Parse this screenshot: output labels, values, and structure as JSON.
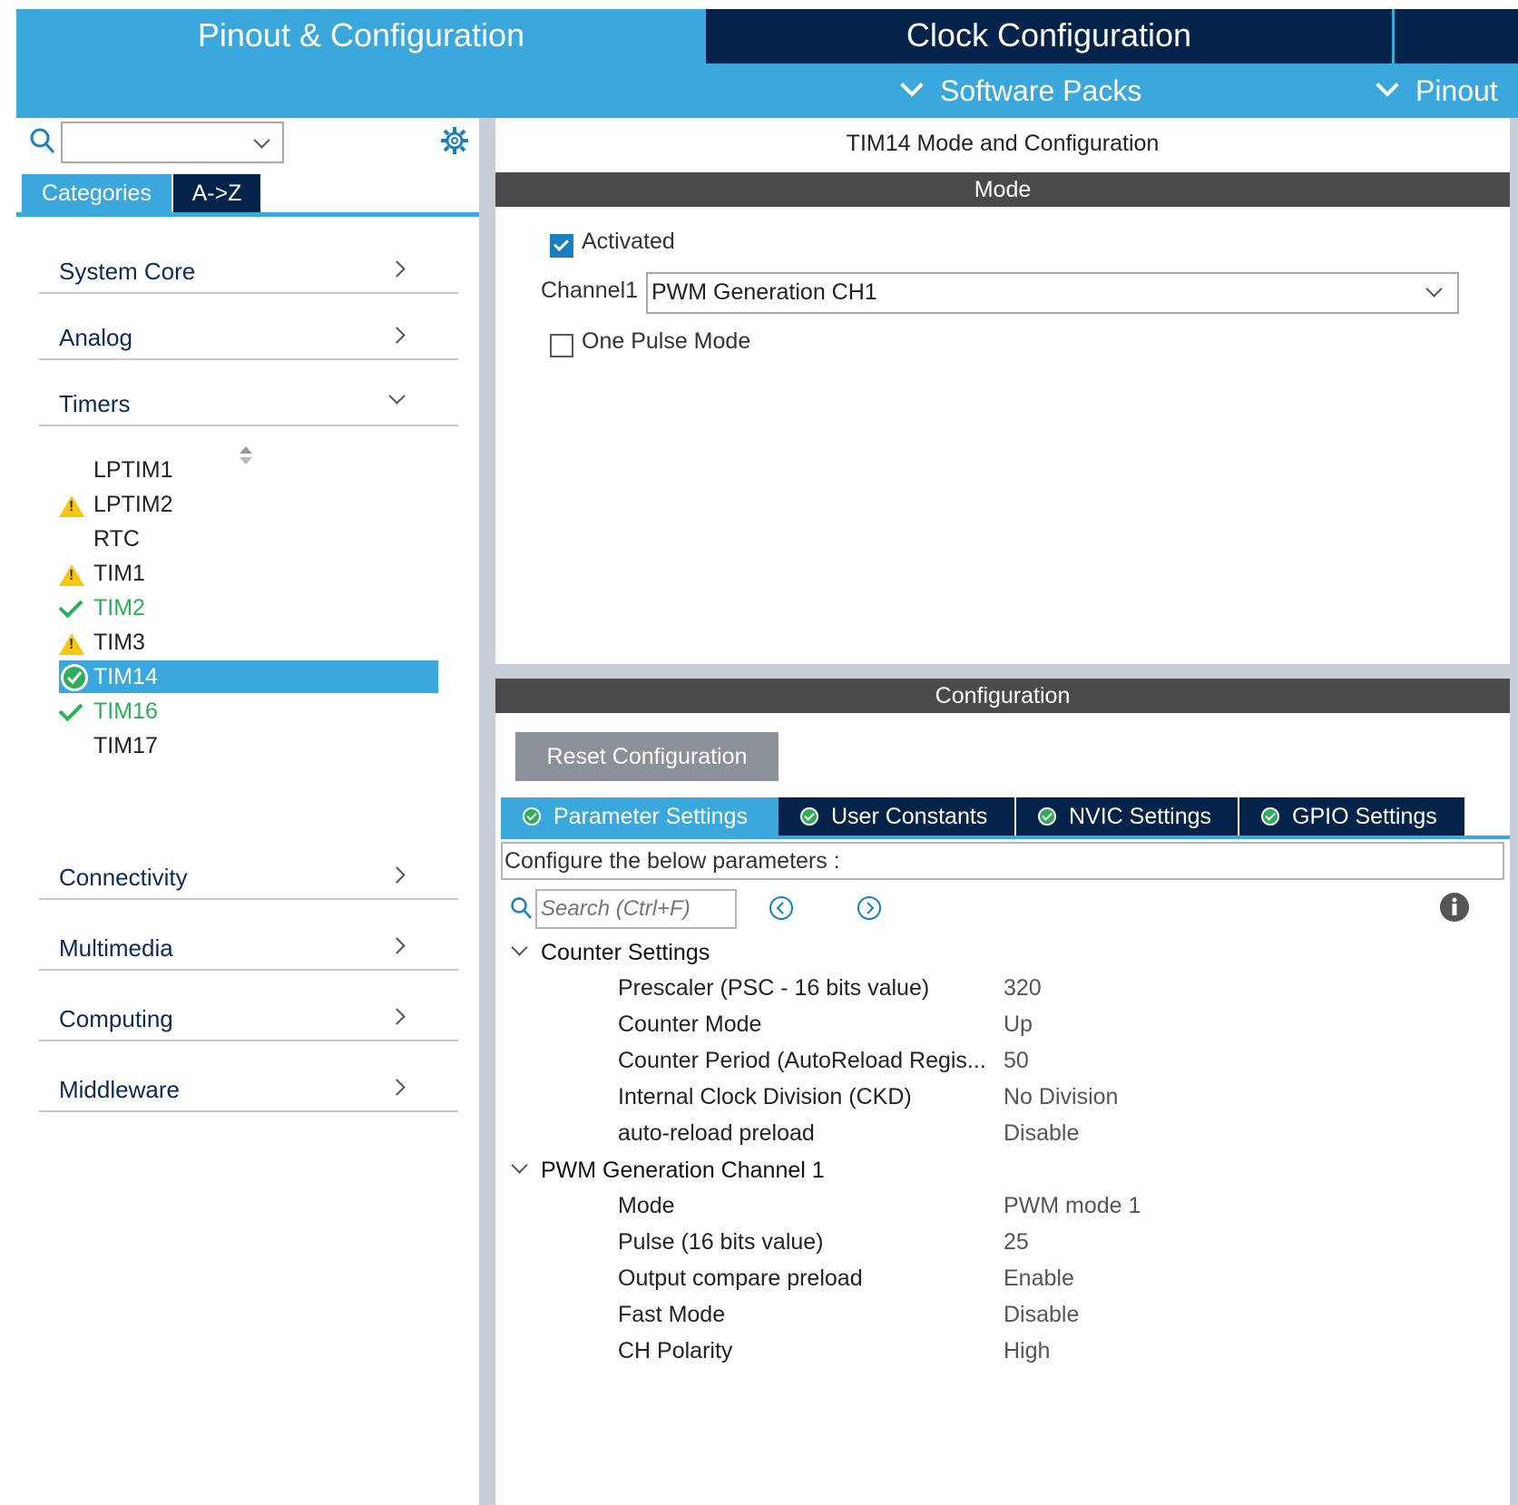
{
  "tabs": {
    "pinout": "Pinout & Configuration",
    "clock": "Clock Configuration"
  },
  "subbar": {
    "software_packs": "Software Packs",
    "pinout": "Pinout"
  },
  "left": {
    "search_value": "",
    "view_tabs": [
      "Categories",
      "A->Z"
    ],
    "categories_top": [
      "System Core",
      "Analog",
      "Timers"
    ],
    "timers": [
      {
        "label": "LPTIM1",
        "status": "none"
      },
      {
        "label": "LPTIM2",
        "status": "warning"
      },
      {
        "label": "RTC",
        "status": "none"
      },
      {
        "label": "TIM1",
        "status": "warning"
      },
      {
        "label": "TIM2",
        "status": "ok"
      },
      {
        "label": "TIM3",
        "status": "warning"
      },
      {
        "label": "TIM14",
        "status": "selected"
      },
      {
        "label": "TIM16",
        "status": "ok"
      },
      {
        "label": "TIM17",
        "status": "none"
      }
    ],
    "categories_bottom": [
      "Connectivity",
      "Multimedia",
      "Computing",
      "Middleware"
    ]
  },
  "right": {
    "title": "TIM14 Mode and Configuration",
    "mode_header": "Mode",
    "activated_label": "Activated",
    "activated": true,
    "channel_label": "Channel1",
    "channel_value": "PWM Generation CH1",
    "one_pulse_label": "One Pulse Mode",
    "one_pulse": false,
    "config_header": "Configuration",
    "reset_button": "Reset Configuration",
    "config_tabs": [
      "Parameter Settings",
      "User Constants",
      "NVIC Settings",
      "GPIO Settings"
    ],
    "configure_text": "Configure the below parameters :",
    "search_placeholder": "Search (Ctrl+F)",
    "groups": [
      {
        "title": "Counter Settings",
        "params": [
          {
            "name": "Prescaler (PSC - 16 bits value)",
            "value": "320"
          },
          {
            "name": "Counter Mode",
            "value": "Up"
          },
          {
            "name": "Counter Period (AutoReload Regis...",
            "value": "50"
          },
          {
            "name": "Internal Clock Division (CKD)",
            "value": "No Division"
          },
          {
            "name": "auto-reload preload",
            "value": "Disable"
          }
        ]
      },
      {
        "title": "PWM Generation Channel 1",
        "params": [
          {
            "name": "Mode",
            "value": "PWM mode 1"
          },
          {
            "name": "Pulse (16 bits value)",
            "value": "25"
          },
          {
            "name": "Output compare preload",
            "value": "Enable"
          },
          {
            "name": "Fast Mode",
            "value": "Disable"
          },
          {
            "name": "CH Polarity",
            "value": "High"
          }
        ]
      }
    ]
  },
  "colors": {
    "accent_blue": "#3aa8dc",
    "navy": "#03234b",
    "ok_green": "#2fae5a",
    "warning_yellow": "#f7c614"
  }
}
